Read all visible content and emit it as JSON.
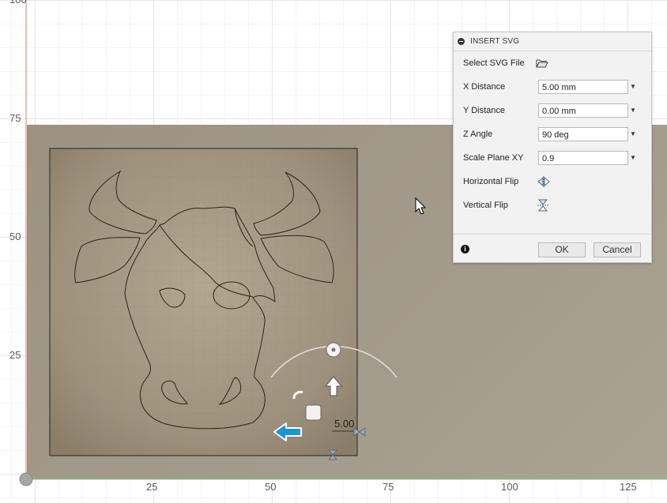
{
  "canvas": {
    "y_axis_labels": [
      "100",
      "75",
      "50",
      "25"
    ],
    "x_axis_labels": [
      "25",
      "50",
      "75",
      "100",
      "125"
    ],
    "manipulator_value": "5.00"
  },
  "panel": {
    "title": "INSERT SVG",
    "select_file_label": "Select SVG File",
    "rows": [
      {
        "label": "X Distance",
        "value": "5.00 mm"
      },
      {
        "label": "Y Distance",
        "value": "0.00 mm"
      },
      {
        "label": "Z Angle",
        "value": "90 deg"
      },
      {
        "label": "Scale Plane XY",
        "value": "0.9"
      }
    ],
    "horizontal_flip_label": "Horizontal Flip",
    "vertical_flip_label": "Vertical Flip",
    "ok_label": "OK",
    "cancel_label": "Cancel"
  },
  "colors": {
    "plate": "#a39b8b",
    "sketch_fill": "#9a8c77",
    "accent_blue": "#1c95d4",
    "axis_red": "#e07a6a",
    "axis_green": "#7fcf7f"
  },
  "icons": [
    "collapse-icon",
    "folder-icon",
    "horizontal-flip-icon",
    "vertical-flip-icon",
    "info-icon",
    "cursor-icon"
  ]
}
